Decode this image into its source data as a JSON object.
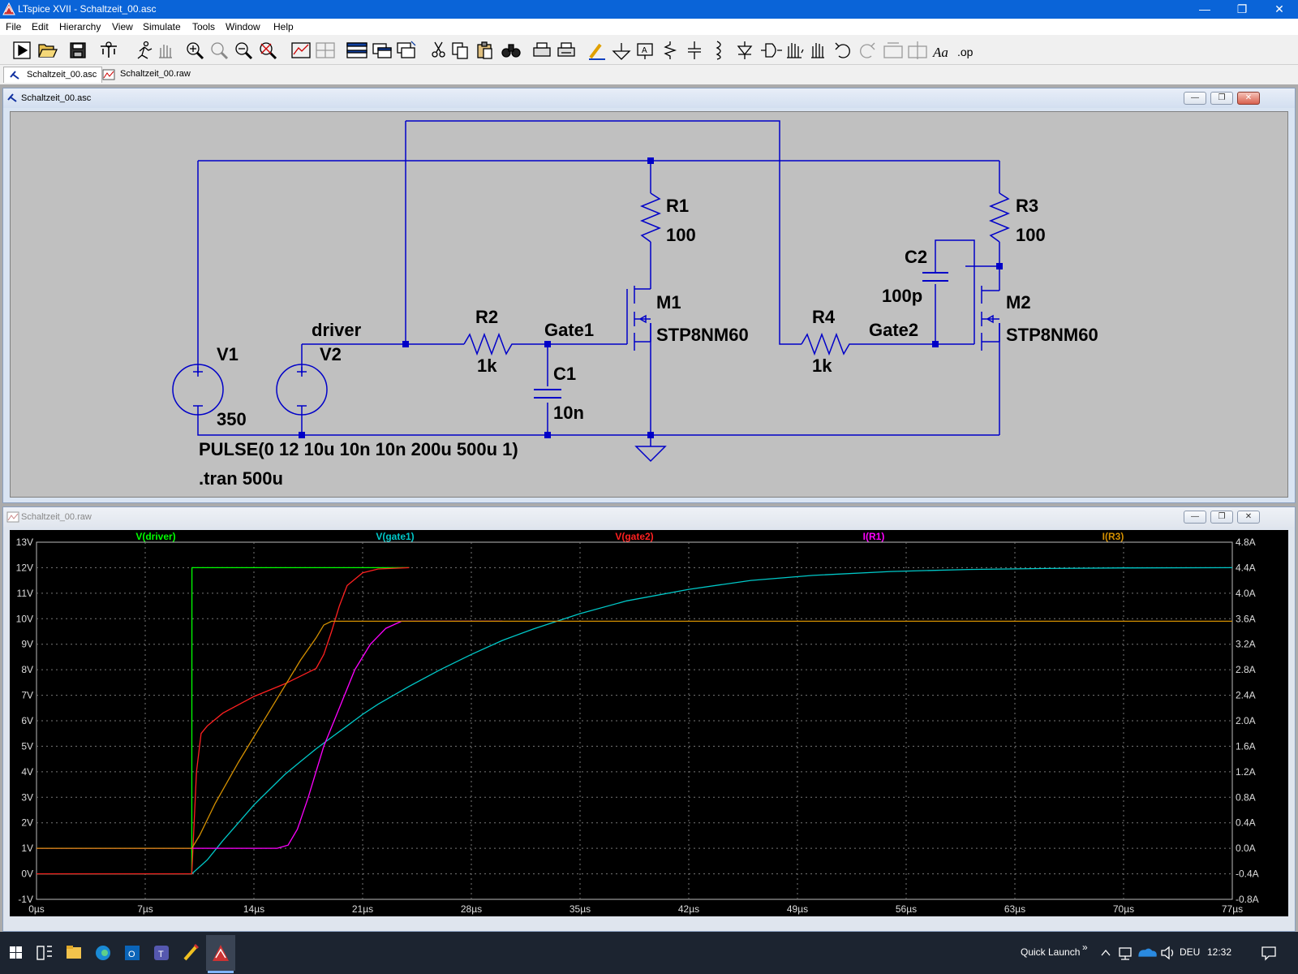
{
  "app": {
    "title": "LTspice XVII - Schaltzeit_00.asc"
  },
  "caption": {
    "minimize": "—",
    "restore": "❐",
    "close": "✕"
  },
  "menu": [
    "File",
    "Edit",
    "Hierarchy",
    "View",
    "Simulate",
    "Tools",
    "Window",
    "Help"
  ],
  "tabs": [
    {
      "label": "Schaltzeit_00.asc",
      "icon": "schematic-icon"
    },
    {
      "label": "Schaltzeit_00.raw",
      "icon": "waveform-icon"
    }
  ],
  "schematic": {
    "title": "Schaltzeit_00.asc",
    "labels": {
      "v1": "V1",
      "v1_value": "350",
      "v2": "V2",
      "driver": "driver",
      "v2_value": "PULSE(0 12 10u 10n 10n 200u 500u 1)",
      "tran": ".tran 500u",
      "r1": "R1",
      "r1_value": "100",
      "r2": "R2",
      "r2_value": "1k",
      "r3": "R3",
      "r3_value": "100",
      "r4": "R4",
      "r4_value": "1k",
      "c1": "C1",
      "c1_value": "10n",
      "c2": "C2",
      "c2_value": "100p",
      "m1": "M1",
      "m1_model": "STP8NM60",
      "m2": "M2",
      "m2_model": "STP8NM60",
      "gate1": "Gate1",
      "gate2": "Gate2"
    }
  },
  "waveform": {
    "title": "Schaltzeit_00.raw",
    "colors": {
      "driver": "#00ff00",
      "gate1": "#00c8c8",
      "gate2": "#ff2020",
      "ir1": "#ff00ff",
      "ir3": "#d49000"
    }
  },
  "chart_data": {
    "type": "line",
    "xlabel": "",
    "ylabel": "",
    "x_ticks": [
      "0µs",
      "7µs",
      "14µs",
      "21µs",
      "28µs",
      "35µs",
      "42µs",
      "49µs",
      "56µs",
      "63µs",
      "70µs",
      "77µs"
    ],
    "xlim": [
      0,
      77
    ],
    "y_left_ticks": [
      "13V",
      "12V",
      "11V",
      "10V",
      "9V",
      "8V",
      "7V",
      "6V",
      "5V",
      "4V",
      "3V",
      "2V",
      "1V",
      "0V",
      "-1V"
    ],
    "ylim_left": [
      -1,
      13
    ],
    "y_right_ticks": [
      "4.8A",
      "4.4A",
      "4.0A",
      "3.6A",
      "3.2A",
      "2.8A",
      "2.4A",
      "2.0A",
      "1.6A",
      "1.2A",
      "0.8A",
      "0.4A",
      "0.0A",
      "-0.4A",
      "-0.8A"
    ],
    "ylim_right": [
      -0.8,
      4.8
    ],
    "grid": true,
    "series": [
      {
        "name": "V(driver)",
        "axis": "left",
        "x": [
          0,
          10,
          10.01,
          24
        ],
        "y": [
          0,
          0,
          12,
          12
        ]
      },
      {
        "name": "V(gate1)",
        "axis": "left",
        "x": [
          0,
          10,
          11,
          12,
          13,
          14,
          15,
          16,
          17,
          18,
          19,
          20,
          21,
          22,
          24,
          26,
          28,
          30,
          32,
          35,
          38,
          42,
          46,
          50,
          55,
          60,
          65,
          70,
          77
        ],
        "y": [
          0,
          0,
          0.55,
          1.3,
          2.0,
          2.7,
          3.3,
          3.9,
          4.4,
          4.9,
          5.35,
          5.8,
          6.25,
          6.65,
          7.35,
          8.0,
          8.6,
          9.15,
          9.6,
          10.2,
          10.7,
          11.15,
          11.5,
          11.7,
          11.85,
          11.93,
          11.97,
          11.99,
          12.0
        ]
      },
      {
        "name": "V(gate2)",
        "axis": "left",
        "x": [
          0,
          10,
          10.3,
          10.6,
          11,
          12,
          14,
          16,
          18,
          18.5,
          19,
          19.5,
          20,
          21,
          22,
          24
        ],
        "y": [
          0,
          0,
          4,
          5.5,
          5.8,
          6.3,
          6.95,
          7.45,
          8.05,
          8.6,
          9.5,
          10.5,
          11.3,
          11.8,
          11.95,
          12.0
        ]
      },
      {
        "name": "I(R1)",
        "axis": "right",
        "x": [
          0,
          10,
          12,
          14,
          15.5,
          16.2,
          16.8,
          17.5,
          18.5,
          19.5,
          20.5,
          21.5,
          22.5,
          23.5,
          25,
          28,
          30
        ],
        "y": [
          0,
          0,
          0,
          0,
          0,
          0.05,
          0.3,
          0.8,
          1.6,
          2.2,
          2.8,
          3.2,
          3.45,
          3.56,
          3.56,
          3.56,
          3.56
        ]
      },
      {
        "name": "I(R3)",
        "axis": "right",
        "x": [
          0,
          10,
          10.5,
          11.5,
          13,
          14.5,
          16,
          17,
          18,
          18.5,
          19,
          20,
          25,
          40,
          60,
          77
        ],
        "y": [
          0,
          0,
          0.2,
          0.7,
          1.35,
          1.95,
          2.55,
          2.95,
          3.3,
          3.5,
          3.56,
          3.56,
          3.56,
          3.56,
          3.56,
          3.56
        ]
      }
    ]
  },
  "taskbar": {
    "quick_launch": "Quick Launch",
    "quick_launch_chevron": "»",
    "language": "DEU",
    "time": "12:32"
  }
}
